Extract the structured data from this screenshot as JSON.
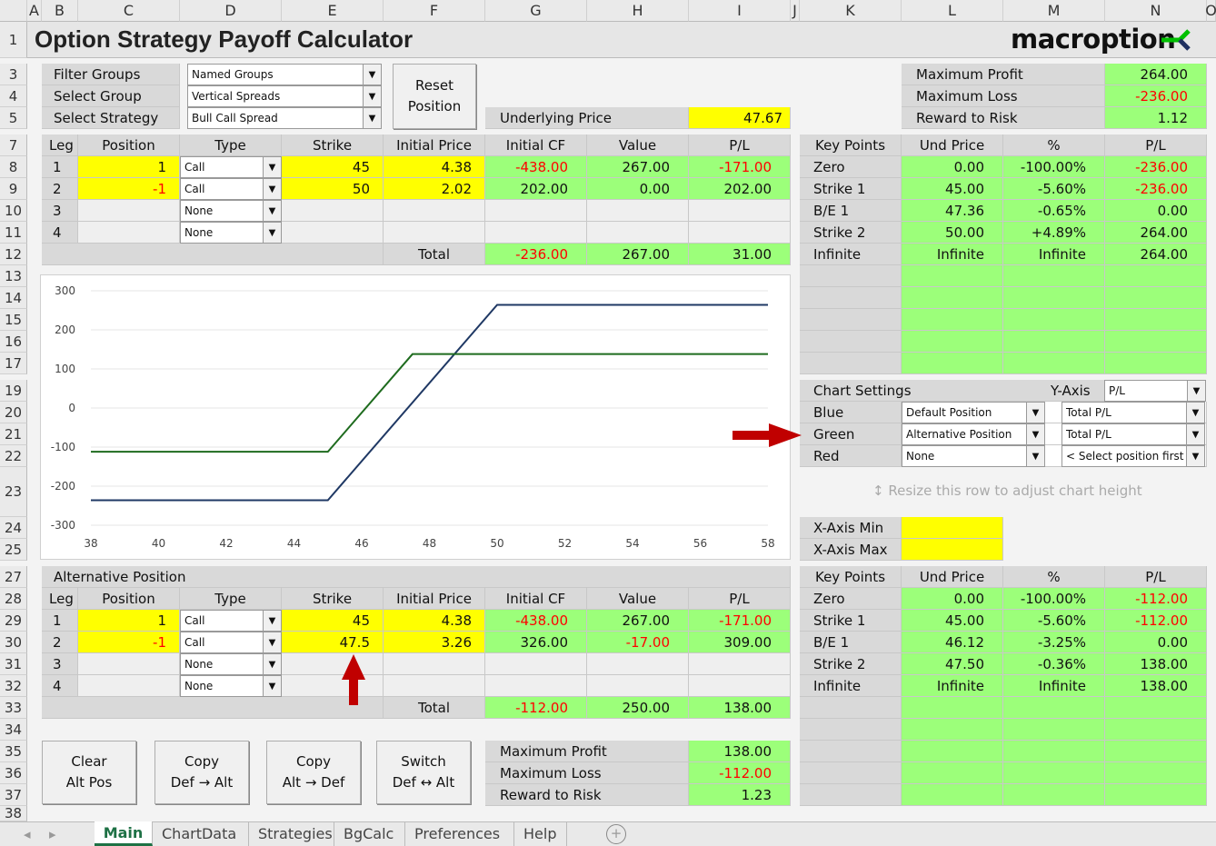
{
  "title": "Option Strategy Payoff Calculator",
  "logo": {
    "text": "macroption",
    "colors": [
      "#00c000",
      "#1f3060"
    ]
  },
  "columns": [
    "A",
    "B",
    "C",
    "D",
    "E",
    "F",
    "G",
    "H",
    "I",
    "J",
    "K",
    "L",
    "M",
    "N",
    "O"
  ],
  "rows": [
    "1",
    "3",
    "4",
    "5",
    "7",
    "8",
    "9",
    "10",
    "11",
    "12",
    "13",
    "14",
    "15",
    "16",
    "17",
    "19",
    "20",
    "21",
    "22",
    "23",
    "24",
    "25",
    "27",
    "28",
    "29",
    "30",
    "31",
    "32",
    "33",
    "34",
    "35",
    "36",
    "37",
    "38"
  ],
  "selectors": [
    {
      "label": "Filter Groups",
      "value": "Named Groups"
    },
    {
      "label": "Select Group",
      "value": "Vertical Spreads"
    },
    {
      "label": "Select Strategy",
      "value": "Bull Call Spread"
    }
  ],
  "reset_button": [
    "Reset",
    "Position"
  ],
  "underlying": {
    "label": "Underlying Price",
    "value": "47.67"
  },
  "summary": [
    {
      "label": "Maximum Profit",
      "value": "264.00"
    },
    {
      "label": "Maximum Loss",
      "value": "-236.00"
    },
    {
      "label": "Reward to Risk",
      "value": "1.12"
    }
  ],
  "leg_headers": [
    "Leg",
    "Position",
    "Type",
    "Strike",
    "Initial Price",
    "Initial CF",
    "Value",
    "P/L"
  ],
  "legs": [
    {
      "leg": "1",
      "position": "1",
      "type": "Call",
      "strike": "45",
      "price": "4.38",
      "cf": "-438.00",
      "value": "267.00",
      "pl": "-171.00"
    },
    {
      "leg": "2",
      "position": "-1",
      "type": "Call",
      "strike": "50",
      "price": "2.02",
      "cf": "202.00",
      "value": "0.00",
      "pl": "202.00"
    },
    {
      "leg": "3",
      "position": "",
      "type": "None",
      "strike": "",
      "price": "",
      "cf": "",
      "value": "",
      "pl": ""
    },
    {
      "leg": "4",
      "position": "",
      "type": "None",
      "strike": "",
      "price": "",
      "cf": "",
      "value": "",
      "pl": ""
    }
  ],
  "total": {
    "label": "Total",
    "cf": "-236.00",
    "value": "267.00",
    "pl": "31.00"
  },
  "kp_headers": [
    "Key Points",
    "Und Price",
    "%",
    "P/L"
  ],
  "key_points": [
    {
      "name": "Zero",
      "price": "0.00",
      "pct": "-100.00%",
      "pl": "-236.00"
    },
    {
      "name": "Strike 1",
      "price": "45.00",
      "pct": "-5.60%",
      "pl": "-236.00"
    },
    {
      "name": "B/E 1",
      "price": "47.36",
      "pct": "-0.65%",
      "pl": "0.00"
    },
    {
      "name": "Strike 2",
      "price": "50.00",
      "pct": "+4.89%",
      "pl": "264.00"
    },
    {
      "name": "Infinite",
      "price": "Infinite",
      "pct": "Infinite",
      "pl": "264.00"
    }
  ],
  "chart_settings": {
    "title": "Chart Settings",
    "yaxis_label": "Y-Axis",
    "yaxis_value": "P/L",
    "rows": [
      {
        "label": "Blue",
        "position": "Default Position",
        "series": "Total P/L"
      },
      {
        "label": "Green",
        "position": "Alternative Position",
        "series": "Total P/L"
      },
      {
        "label": "Red",
        "position": "None",
        "series": "< Select position first"
      }
    ]
  },
  "resize_hint": "↕ Resize this row to adjust chart height",
  "xaxis": {
    "min_label": "X-Axis Min",
    "max_label": "X-Axis Max",
    "min": "",
    "max": ""
  },
  "alt": {
    "title": "Alternative Position",
    "legs": [
      {
        "leg": "1",
        "position": "1",
        "type": "Call",
        "strike": "45",
        "price": "4.38",
        "cf": "-438.00",
        "value": "267.00",
        "pl": "-171.00"
      },
      {
        "leg": "2",
        "position": "-1",
        "type": "Call",
        "strike": "47.5",
        "price": "3.26",
        "cf": "326.00",
        "value": "-17.00",
        "pl": "309.00"
      },
      {
        "leg": "3",
        "position": "",
        "type": "None",
        "strike": "",
        "price": "",
        "cf": "",
        "value": "",
        "pl": ""
      },
      {
        "leg": "4",
        "position": "",
        "type": "None",
        "strike": "",
        "price": "",
        "cf": "",
        "value": "",
        "pl": ""
      }
    ],
    "total": {
      "label": "Total",
      "cf": "-112.00",
      "value": "250.00",
      "pl": "138.00"
    },
    "key_points": [
      {
        "name": "Zero",
        "price": "0.00",
        "pct": "-100.00%",
        "pl": "-112.00"
      },
      {
        "name": "Strike 1",
        "price": "45.00",
        "pct": "-5.60%",
        "pl": "-112.00"
      },
      {
        "name": "B/E 1",
        "price": "46.12",
        "pct": "-3.25%",
        "pl": "0.00"
      },
      {
        "name": "Strike 2",
        "price": "47.50",
        "pct": "-0.36%",
        "pl": "138.00"
      },
      {
        "name": "Infinite",
        "price": "Infinite",
        "pct": "Infinite",
        "pl": "138.00"
      }
    ],
    "summary": [
      {
        "label": "Maximum Profit",
        "value": "138.00"
      },
      {
        "label": "Maximum Loss",
        "value": "-112.00"
      },
      {
        "label": "Reward to Risk",
        "value": "1.23"
      }
    ]
  },
  "buttons": [
    [
      "Clear",
      "Alt Pos"
    ],
    [
      "Copy",
      "Def → Alt"
    ],
    [
      "Copy",
      "Alt → Def"
    ],
    [
      "Switch",
      "Def ↔ Alt"
    ]
  ],
  "tabs": [
    "Main",
    "ChartData",
    "Strategies",
    "BgCalc",
    "Preferences",
    "Help"
  ],
  "active_tab": "Main",
  "chart_data": {
    "type": "line",
    "xlim": [
      38,
      58
    ],
    "ylim": [
      -300,
      300
    ],
    "xticks": [
      "38",
      "40",
      "42",
      "44",
      "46",
      "48",
      "50",
      "52",
      "54",
      "56",
      "58"
    ],
    "yticks": [
      "300",
      "200",
      "100",
      "0",
      "-100",
      "-200",
      "-300"
    ],
    "grid": true,
    "series": [
      {
        "color": "#1f3864",
        "points": [
          [
            38,
            -236
          ],
          [
            45,
            -236
          ],
          [
            50,
            264
          ],
          [
            58,
            264
          ]
        ]
      },
      {
        "color": "#1e6b1e",
        "points": [
          [
            38,
            -112
          ],
          [
            45,
            -112
          ],
          [
            47.5,
            138
          ],
          [
            58,
            138
          ]
        ]
      }
    ]
  },
  "colors": {
    "label_gray": "#d9d9d9",
    "output_green": "#9cff7a",
    "input_yellow": "#ffff00",
    "negative": "#ff0000",
    "arrow": "#c00000"
  }
}
